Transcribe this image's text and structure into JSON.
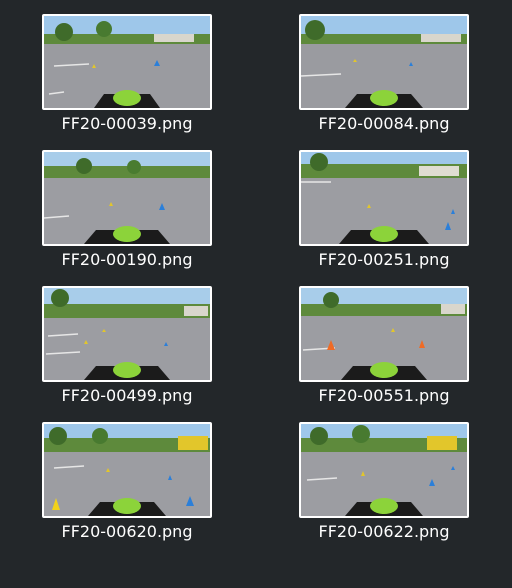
{
  "files": [
    {
      "name": "FF20-00039.png",
      "scene": "image-track-cones-a"
    },
    {
      "name": "FF20-00084.png",
      "scene": "image-track-cones-b"
    },
    {
      "name": "FF20-00190.png",
      "scene": "image-track-cones-c"
    },
    {
      "name": "FF20-00251.png",
      "scene": "image-track-cones-d"
    },
    {
      "name": "FF20-00499.png",
      "scene": "image-track-cones-e"
    },
    {
      "name": "FF20-00551.png",
      "scene": "image-track-cones-f"
    },
    {
      "name": "FF20-00620.png",
      "scene": "image-track-cones-g"
    },
    {
      "name": "FF20-00622.png",
      "scene": "image-track-cones-h"
    }
  ],
  "colors": {
    "background": "#23272a",
    "text": "#ffffff",
    "thumb_border": "#ffffff"
  }
}
